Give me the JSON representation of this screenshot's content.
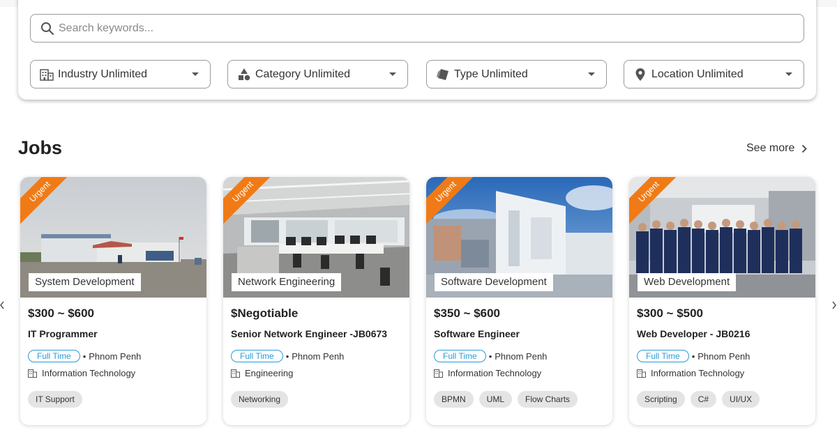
{
  "search": {
    "placeholder": "Search keywords..."
  },
  "filters": [
    {
      "label": "Industry Unlimited",
      "icon": "building-icon"
    },
    {
      "label": "Category Unlimited",
      "icon": "shapes-icon"
    },
    {
      "label": "Type Unlimited",
      "icon": "tag-icon"
    },
    {
      "label": "Location Unlimited",
      "icon": "location-pin-icon"
    }
  ],
  "jobs_section": {
    "title": "Jobs",
    "see_more": "See more"
  },
  "jobs": [
    {
      "badge": "Urgent",
      "category": "System Development",
      "salary": "$300 ~ $600",
      "title": "IT Programmer",
      "type": "Full Time",
      "location": "Phnom Penh",
      "industry": "Information Technology",
      "tags": [
        "IT Support"
      ]
    },
    {
      "badge": "Urgent",
      "category": "Network Engineering",
      "salary": "$Negotiable",
      "title": "Senior Network Engineer -JB0673",
      "type": "Full Time",
      "location": "Phnom Penh",
      "industry": "Engineering",
      "tags": [
        "Networking"
      ]
    },
    {
      "badge": "Urgent",
      "category": "Software Development",
      "salary": "$350 ~ $600",
      "title": "Software Engineer",
      "type": "Full Time",
      "location": "Phnom Penh",
      "industry": "Information Technology",
      "tags": [
        "BPMN",
        "UML",
        "Flow Charts"
      ]
    },
    {
      "badge": "Urgent",
      "category": "Web Development",
      "salary": "$300 ~ $500",
      "title": "Web Developer - JB0216",
      "type": "Full Time",
      "location": "Phnom Penh",
      "industry": "Information Technology",
      "tags": [
        "Scripting",
        "C#",
        "UI/UX"
      ]
    }
  ],
  "colors": {
    "accent": "#2b9bd6",
    "ribbon": "#f07b16",
    "tag_bg": "#e4e4e4"
  }
}
